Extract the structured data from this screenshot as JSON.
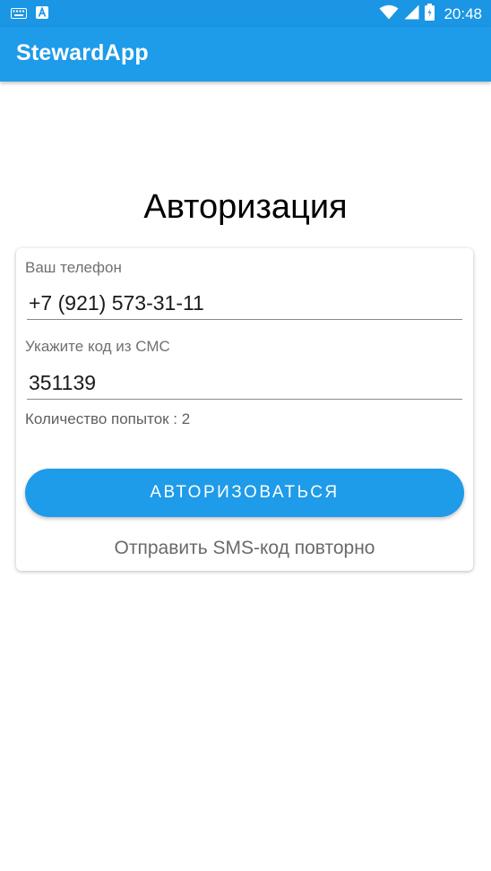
{
  "status_bar": {
    "time": "20:48",
    "icons": [
      "keyboard-icon",
      "a-notification-icon",
      "wifi-icon",
      "signal-icon",
      "battery-icon"
    ]
  },
  "app_bar": {
    "title": "StewardApp"
  },
  "page": {
    "title": "Авторизация"
  },
  "form": {
    "phone": {
      "label": "Ваш телефон",
      "value": "+7 (921) 573-31-11"
    },
    "sms_code": {
      "label": "Укажите код из СМС",
      "value": "351139"
    },
    "attempts_text": "Количество попыток : 2",
    "submit_label": "АВТОРИЗОВАТЬСЯ",
    "resend_label": "Отправить SMS-код повторно"
  },
  "colors": {
    "status_bar": "#1a96e4",
    "app_bar": "#1e9be9",
    "button": "#1e9be9"
  }
}
